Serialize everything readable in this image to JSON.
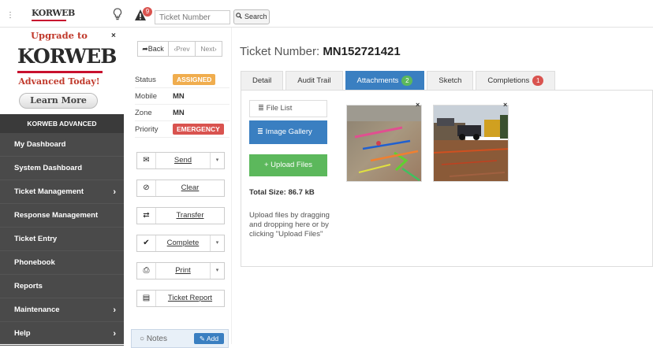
{
  "topbar": {
    "brand": "KORWEB",
    "alert_count": "9",
    "ticket_placeholder": "Ticket Number",
    "search_label": "Search"
  },
  "upgrade": {
    "title": "Upgrade to",
    "logo": "KORWEB",
    "subtitle": "Advanced Today!",
    "learn_more": "Learn More",
    "close": "×"
  },
  "sidebar": {
    "header": "KORWEB ADVANCED",
    "items": [
      {
        "label": "My Dashboard",
        "chevron": ""
      },
      {
        "label": "System Dashboard",
        "chevron": ""
      },
      {
        "label": "Ticket Management",
        "chevron": "›"
      },
      {
        "label": "Response Management",
        "chevron": ""
      },
      {
        "label": "Ticket Entry",
        "chevron": ""
      },
      {
        "label": "Phonebook",
        "chevron": ""
      },
      {
        "label": "Reports",
        "chevron": ""
      },
      {
        "label": "Maintenance",
        "chevron": "›"
      },
      {
        "label": "Help",
        "chevron": "›"
      }
    ]
  },
  "navigation": {
    "back": "Back",
    "prev": "‹Prev",
    "next": "Next›"
  },
  "ticket_info": {
    "status_label": "Status",
    "status_value": "ASSIGNED",
    "mobile_label": "Mobile",
    "mobile_value": "MN",
    "zone_label": "Zone",
    "zone_value": "MN",
    "priority_label": "Priority",
    "priority_value": "EMERGENCY"
  },
  "actions": [
    {
      "label": "Send",
      "icon": "envelope-icon",
      "dropdown": true
    },
    {
      "label": "Clear",
      "icon": "ban-icon",
      "dropdown": false
    },
    {
      "label": "Transfer",
      "icon": "exchange-icon",
      "dropdown": false
    },
    {
      "label": "Complete",
      "icon": "check-icon",
      "dropdown": true
    },
    {
      "label": "Print",
      "icon": "print-icon",
      "dropdown": true
    },
    {
      "label": "Ticket Report",
      "icon": "report-icon",
      "dropdown": false
    }
  ],
  "notes": {
    "label": "Notes",
    "add": "Add"
  },
  "main": {
    "ticket_label": "Ticket Number:",
    "ticket_number": "MN152721421"
  },
  "tabs": [
    {
      "label": "Detail",
      "badge": "",
      "active": false
    },
    {
      "label": "Audit Trail",
      "badge": "",
      "active": false
    },
    {
      "label": "Attachments",
      "badge": "2",
      "active": true
    },
    {
      "label": "Sketch",
      "badge": "",
      "active": false
    },
    {
      "label": "Completions",
      "badge": "1",
      "active": false
    }
  ],
  "attachments": {
    "file_list": "File List",
    "image_gallery": "Image Gallery",
    "upload_files": "+ Upload Files",
    "total_size": "Total Size: 86.7 kB",
    "upload_help": "Upload files by dragging and dropping here or by clicking \"Upload Files\"",
    "images": [
      "image-1",
      "image-2"
    ]
  },
  "colors": {
    "sidebar_bg": "#4a4a4a",
    "accent_blue": "#3a7fc1",
    "success_green": "#5cb85c",
    "danger_red": "#d9534f",
    "warning_orange": "#f0ad4e",
    "brand_red": "#c8102e"
  }
}
